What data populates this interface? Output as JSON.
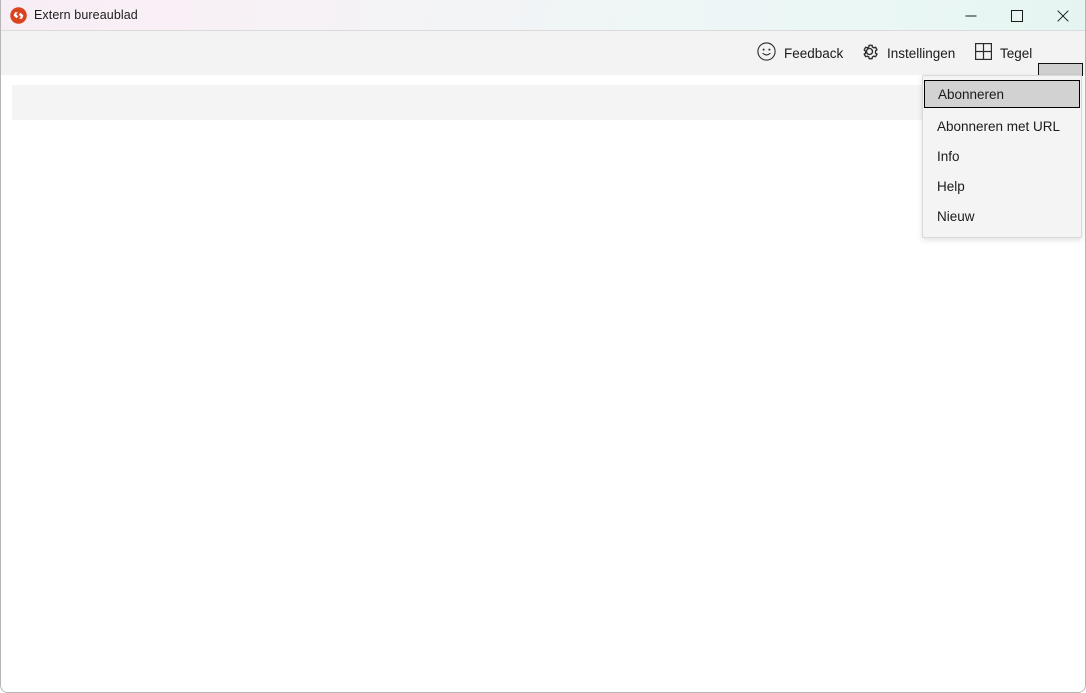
{
  "window": {
    "title": "Extern bureaublad",
    "app_icon": "remote-desktop-icon",
    "controls": {
      "minimize": "─",
      "maximize": "□",
      "close": "✕"
    },
    "colors": {
      "titlebar_left": "#f7eef5",
      "titlebar_right": "#e6f4f1",
      "toolbar_bg": "#f3f3f3",
      "placeholder_bg": "#f4f4f4",
      "menu_bg": "#f4f4f4",
      "menu_selected_bg": "#d2d2d2",
      "border": "#b5b5b5",
      "app_icon_bg": "#d9441f"
    }
  },
  "toolbar": {
    "items": [
      {
        "label": "Feedback",
        "icon": "smiley-face-icon"
      },
      {
        "label": "Instellingen",
        "icon": "gear-icon"
      },
      {
        "label": "Tegel",
        "icon": "grid-tile-icon"
      }
    ],
    "more_button": {
      "label": "…",
      "icon": "ellipsis-icon",
      "pressed": true
    }
  },
  "menu": {
    "items": [
      {
        "label": "Abonneren",
        "selected": true
      },
      {
        "label": "Abonneren met URL",
        "selected": false
      },
      {
        "label": "Info",
        "selected": false
      },
      {
        "label": "Help",
        "selected": false
      },
      {
        "label": "Nieuw",
        "selected": false
      }
    ]
  },
  "content": {
    "placeholder_row": ""
  }
}
